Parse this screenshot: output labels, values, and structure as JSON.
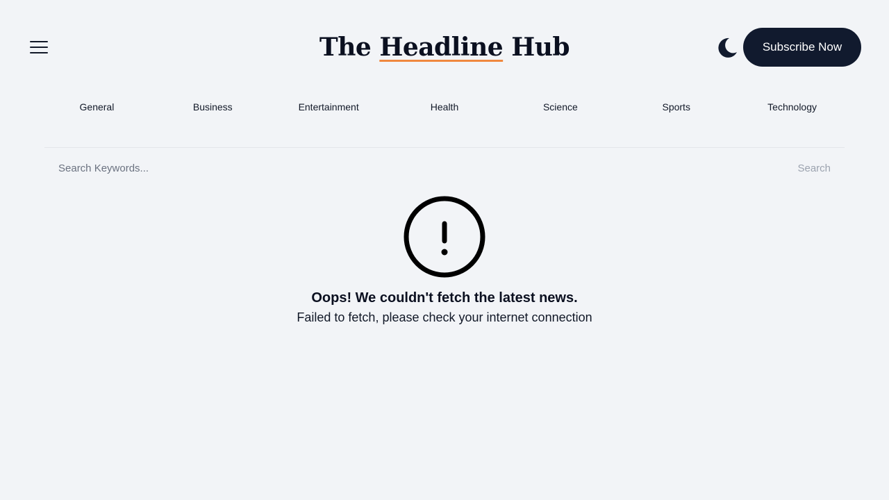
{
  "header": {
    "menu_icon": "hamburger-menu-icon",
    "brand": {
      "part1": "The ",
      "accent": "Headline",
      "part2": " Hub"
    },
    "theme_icon": "moon-icon",
    "subscribe_label": "Subscribe Now"
  },
  "categories": [
    "General",
    "Business",
    "Entertainment",
    "Health",
    "Science",
    "Sports",
    "Technology"
  ],
  "search": {
    "placeholder": "Search Keywords...",
    "value": "",
    "button_label": "Search"
  },
  "error": {
    "icon": "exclamation-circle-icon",
    "title": "Oops! We couldn't fetch the latest news.",
    "message": "Failed to fetch, please check your internet connection"
  },
  "colors": {
    "background": "#f2f4f7",
    "primary_dark": "#111a2e",
    "brand_underline": "#f0883e",
    "muted_text": "#9ca3af"
  }
}
